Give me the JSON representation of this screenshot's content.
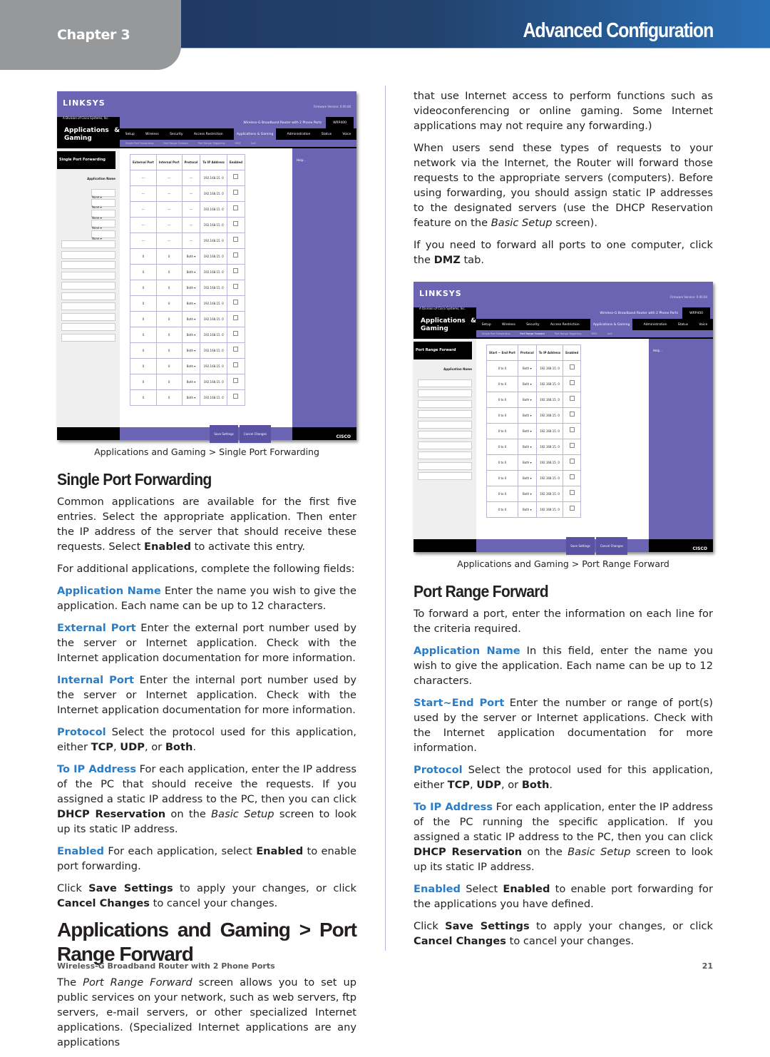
{
  "header": {
    "chapter": "Chapter 3",
    "section": "Advanced Configuration"
  },
  "figure1": {
    "brand": "LINKSYS",
    "brand_sub": "A Division of Cisco Systems, Inc.",
    "firmware": "Firmware Version: 0.00.00",
    "area": "Applications & Gaming",
    "product": "Wireless-G Broadband Router with 2 Phone Ports",
    "model": "WRP400",
    "tabs": [
      "Setup",
      "Wireless",
      "Security",
      "Access Restriction",
      "Applications & Gaming",
      "Administration",
      "Status",
      "Voice"
    ],
    "subtabs": [
      "Single Port Forwarding",
      "Port Range Forward",
      "Port Range Triggering",
      "DMZ",
      "QoS"
    ],
    "panel_title": "Single Port Forwarding",
    "app_name_label": "Application Name",
    "columns": [
      "External Port",
      "Internal Port",
      "Protocol",
      "To IP Address",
      "Enabled"
    ],
    "preset_value": "None",
    "dash": "---",
    "port_value": "0",
    "protocol_value": "Both",
    "ip_prefix": "192.168.15.",
    "ip_suffix": "0",
    "help": "Help...",
    "save": "Save Settings",
    "cancel": "Cancel Changes",
    "cisco": "CISCO",
    "caption": "Applications and Gaming > Single Port Forwarding"
  },
  "figure2": {
    "panel_title": "Port Range Forward",
    "app_name_label": "Application Name",
    "columns": [
      "Start ~ End Port",
      "Protocol",
      "To IP Address",
      "Enabled"
    ],
    "to": "to",
    "port_value": "0",
    "protocol_value": "Both",
    "ip_prefix": "192.168.15.",
    "ip_suffix": "0",
    "caption": "Applications and Gaming > Port Range Forward"
  },
  "left": {
    "h_single": "Single Port Forwarding",
    "p1_a": "Common applications are available for the first five entries. Select the appropriate application. Then enter the IP address of the server that should receive these requests. Select ",
    "p1_b": "Enabled",
    "p1_c": " to activate this entry.",
    "p2": "For additional applications, complete the following fields:",
    "appname_term": "Application Name",
    "appname_text": "  Enter the name you wish to give the application. Each name can be up to 12 characters.",
    "ext_term": "External Port",
    "ext_text": "  Enter the external port number used by the server or Internet application. Check with the Internet application documentation for more information.",
    "int_term": "Internal Port",
    "int_text": "  Enter the internal port number used by the server or Internet application. Check with the Internet application documentation for more information.",
    "proto_term": "Protocol",
    "proto_text": "  Select the protocol used for this application, either ",
    "tcp": "TCP",
    "udp": "UDP",
    "both": "Both",
    "ip_term": "To IP Address",
    "ip_text": "  For each application, enter the IP address of the PC that should receive the requests. If you assigned a static IP address to the PC, then you can click ",
    "dhcp": "DHCP Reservation",
    "on_the": " on the ",
    "basic_setup": "Basic Setup",
    "ip_tail": " screen to look up its static IP address.",
    "en_term": "Enabled",
    "en_text": "  For each application, select ",
    "en_bold": "Enabled",
    "en_tail": " to enable port forwarding.",
    "click": "Click ",
    "save": "Save Settings",
    "mid": " to apply your changes, or click ",
    "cancel": "Cancel Changes",
    "end": " to cancel your changes.",
    "h_prf": "Applications and Gaming > Port Range Forward",
    "prf_a": "The ",
    "prf_i": "Port Range Forward",
    "prf_b": " screen allows you to set up public services on your network, such as web servers, ftp servers, e-mail servers, or other specialized Internet applications. (Specialized Internet applications are any applications"
  },
  "right": {
    "p1": "that use Internet access to perform functions such as videoconferencing or online gaming. Some Internet applications may not require any forwarding.)",
    "p2_a": "When users send these types of requests to your network via the Internet, the Router will forward those requests to the appropriate servers (computers). Before using forwarding, you should assign static IP addresses to the designated servers (use the DHCP Reservation feature on the ",
    "p2_i": "Basic Setup",
    "p2_b": " screen).",
    "p3_a": "If you need to forward all ports to one computer, click the ",
    "p3_b": "DMZ",
    "p3_c": " tab.",
    "h_prf": "Port Range Forward",
    "p4": "To forward a port, enter the information on each line for the criteria required.",
    "appname_term": "Application Name",
    "appname_text": " In this field, enter the name you wish to give the application. Each name can be up to 12 characters.",
    "se_term": "Start~End Port",
    "se_text": "  Enter the number or range of port(s) used by the server or Internet applications. Check with the Internet application documentation for more information.",
    "proto_term": "Protocol",
    "proto_text": "  Select the protocol used for this application, either ",
    "ip_term": "To IP Address",
    "ip_text": "  For each application, enter the IP address of the PC running the specific application. If you assigned a static IP address to the PC, then you can click ",
    "en_term": "Enabled",
    "en_text": "  Select ",
    "en_bold": "Enabled",
    "en_tail": " to enable port forwarding for the applications you have defined."
  },
  "footer": {
    "product": "Wireless-G Broadband Router with 2 Phone Ports",
    "page": "21"
  }
}
